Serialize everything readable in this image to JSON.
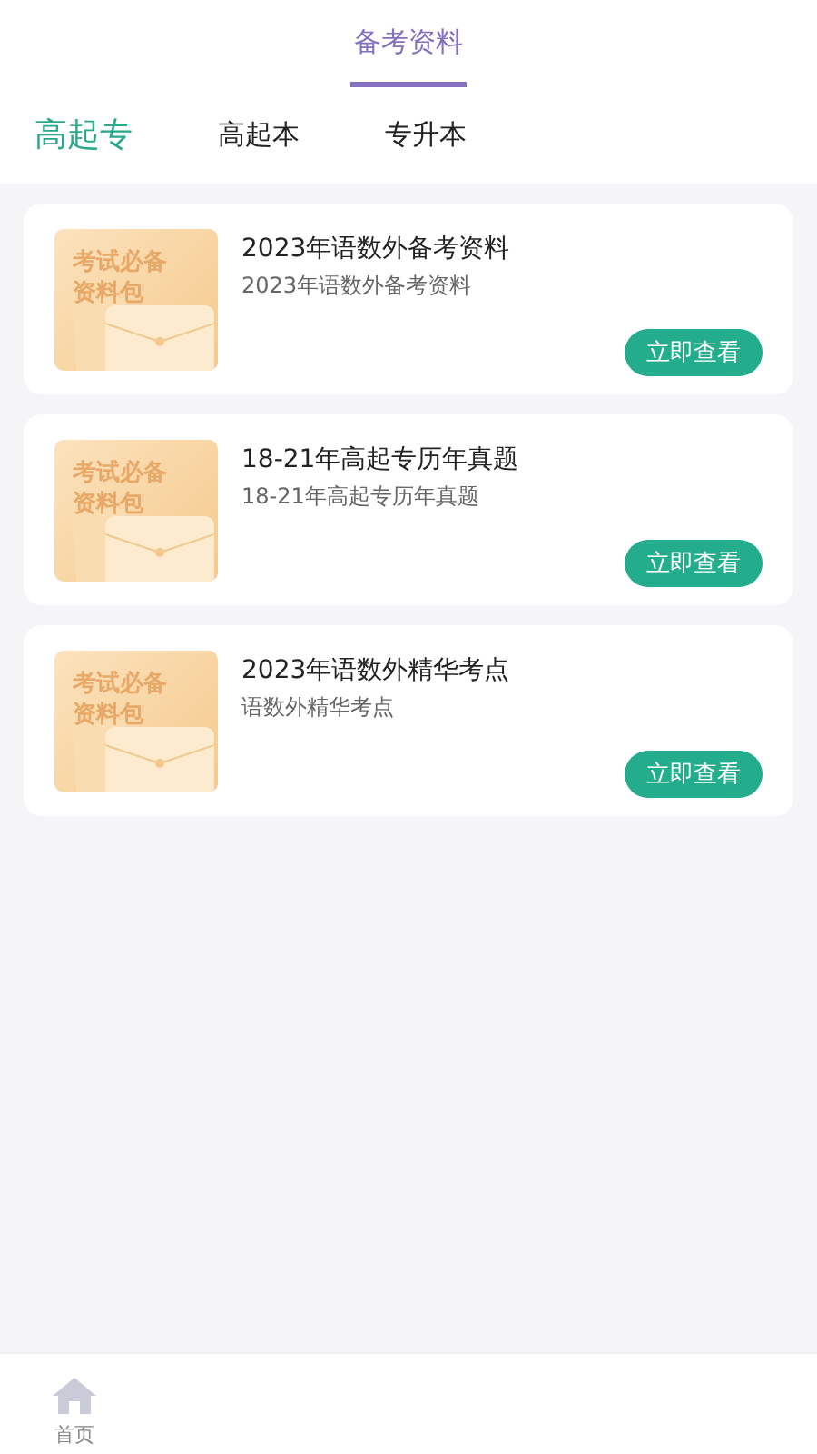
{
  "header": {
    "title": "备考资料"
  },
  "tabs": [
    {
      "label": "高起专",
      "selected": true
    },
    {
      "label": "高起本",
      "selected": false
    },
    {
      "label": "专升本",
      "selected": false
    }
  ],
  "materials": [
    {
      "cover_line_1": "考试必备",
      "cover_line_2": "资料包",
      "title": "2023年语数外备考资料",
      "subtitle": "2023年语数外备考资料",
      "action": "立即查看"
    },
    {
      "cover_line_1": "考试必备",
      "cover_line_2": "资料包",
      "title": "18-21年高起专历年真题",
      "subtitle": "18-21年高起专历年真题",
      "action": "立即查看"
    },
    {
      "cover_line_1": "考试必备",
      "cover_line_2": "资料包",
      "title": "2023年语数外精华考点",
      "subtitle": "语数外精华考点",
      "action": "立即查看"
    }
  ],
  "bottom_nav": [
    {
      "label": "首页",
      "selected": false
    }
  ]
}
